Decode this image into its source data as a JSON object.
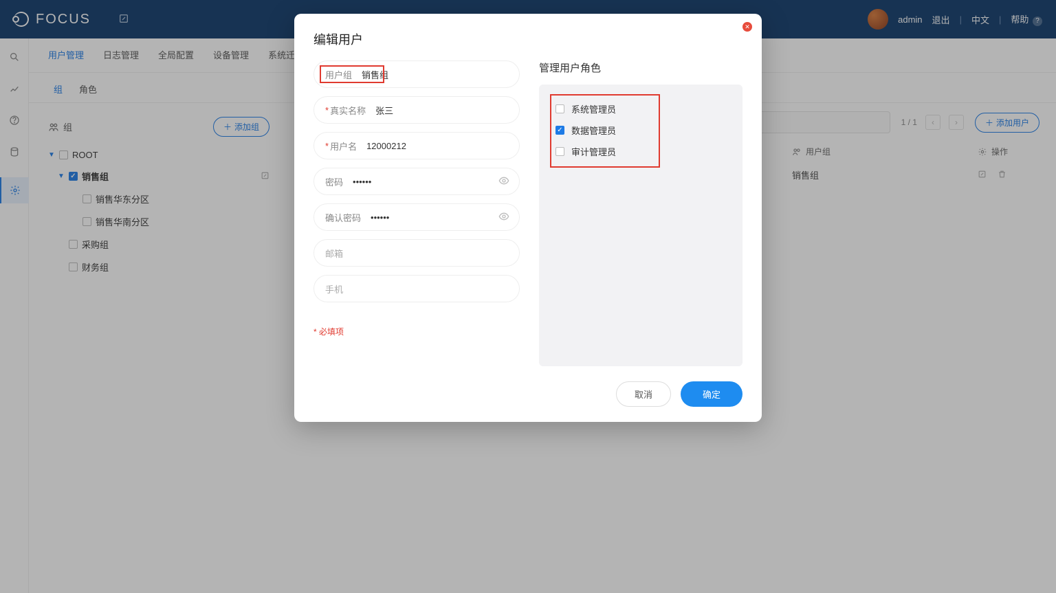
{
  "header": {
    "brand": "FOCUS",
    "user": "admin",
    "logout": "退出",
    "lang": "中文",
    "help": "帮助"
  },
  "nav_tabs": [
    "用户管理",
    "日志管理",
    "全局配置",
    "设备管理",
    "系统迁移"
  ],
  "nav_active": 0,
  "sub_tabs": [
    "组",
    "角色"
  ],
  "sub_active": 0,
  "group_panel": {
    "title": "组",
    "add_button": "添加组"
  },
  "tree": [
    {
      "label": "ROOT",
      "level": 0,
      "checked": false,
      "caret": true,
      "bold": false
    },
    {
      "label": "销售组",
      "level": 1,
      "checked": true,
      "caret": true,
      "bold": true,
      "edit": true
    },
    {
      "label": "销售华东分区",
      "level": 2,
      "checked": false,
      "caret": false
    },
    {
      "label": "销售华南分区",
      "level": 2,
      "checked": false,
      "caret": false
    },
    {
      "label": "采购组",
      "level": 1,
      "checked": false,
      "caret": false
    },
    {
      "label": "财务组",
      "level": 1,
      "checked": false,
      "caret": false
    }
  ],
  "right_panel": {
    "add_user_button": "添加用户",
    "page_info": "1 / 1",
    "col_group": "用户组",
    "col_ops": "操作",
    "row_group_value": "销售组"
  },
  "modal": {
    "title": "编辑用户",
    "roles_title": "管理用户角色",
    "fields": {
      "usergroup_label": "用户组",
      "usergroup_value": "销售组",
      "realname_label": "真实名称",
      "realname_value": "张三",
      "username_label": "用户名",
      "username_value": "12000212",
      "password_label": "密码",
      "password_value": "••••••",
      "confirm_label": "确认密码",
      "confirm_value": "••••••",
      "email_label": "邮箱",
      "phone_label": "手机"
    },
    "roles": [
      {
        "label": "系统管理员",
        "checked": false
      },
      {
        "label": "数据管理员",
        "checked": true
      },
      {
        "label": "审计管理员",
        "checked": false
      }
    ],
    "required_note": "* 必填项",
    "cancel": "取消",
    "confirm": "确定"
  }
}
